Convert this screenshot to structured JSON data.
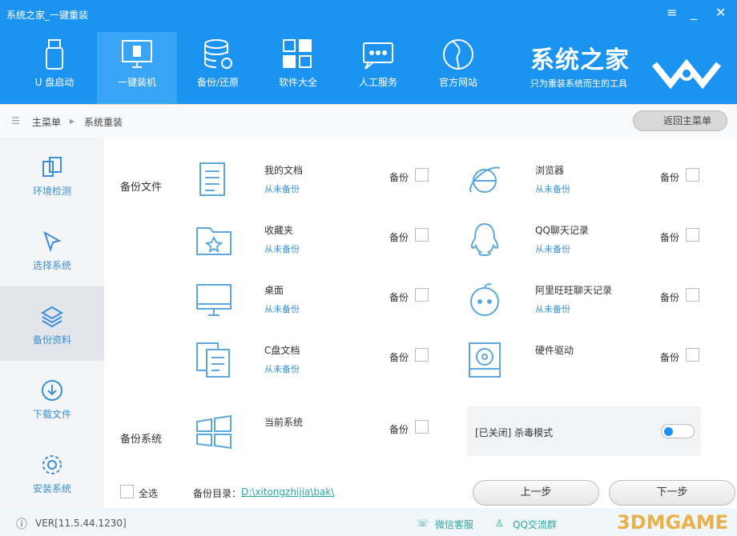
{
  "window": {
    "title": "系统之家_一键重装",
    "menu_icon": "menu-icon",
    "min_icon": "minimize-icon",
    "close_icon": "close-icon"
  },
  "nav": [
    {
      "label": "U 盘启动",
      "icon": "usb-icon"
    },
    {
      "label": "一键装机",
      "icon": "monitor-windows-icon",
      "active": true
    },
    {
      "label": "备份/还原",
      "icon": "database-icon"
    },
    {
      "label": "软件大全",
      "icon": "apps-icon"
    },
    {
      "label": "人工服务",
      "icon": "chat-icon"
    },
    {
      "label": "官方网站",
      "icon": "globe-icon"
    }
  ],
  "brand": {
    "name": "系统之家",
    "slogan": "只为重装系统而生的工具"
  },
  "breadcrumb": {
    "home": "主菜单",
    "current": "系统重装",
    "back": "返回主菜单"
  },
  "sidebar": [
    {
      "label": "环境检测"
    },
    {
      "label": "选择系统"
    },
    {
      "label": "备份资料",
      "active": true
    },
    {
      "label": "下载文件"
    },
    {
      "label": "安装系统"
    }
  ],
  "backup_files": {
    "label": "备份文件",
    "backup_label": "备份",
    "left": [
      {
        "name": "我的文档",
        "status": "从未备份",
        "icon": "document-icon"
      },
      {
        "name": "收藏夹",
        "status": "从未备份",
        "icon": "favorites-folder-icon"
      },
      {
        "name": "桌面",
        "status": "从未备份",
        "icon": "desktop-icon"
      },
      {
        "name": "C盘文档",
        "status": "从未备份",
        "icon": "documents-icon"
      }
    ],
    "right": [
      {
        "name": "浏览器",
        "status": "从未备份",
        "icon": "ie-icon"
      },
      {
        "name": "QQ聊天记录",
        "status": "从未备份",
        "icon": "qq-icon"
      },
      {
        "name": "阿里旺旺聊天记录",
        "status": "从未备份",
        "icon": "wangwang-icon"
      },
      {
        "name": "硬件驱动",
        "status": "",
        "icon": "driver-icon"
      }
    ]
  },
  "backup_system": {
    "label": "备份系统",
    "name": "当前系统",
    "backup_label": "备份"
  },
  "kill_mode": {
    "label": "[已关闭] 杀毒模式"
  },
  "bottom": {
    "select_all": "全选",
    "dir_label": "备份目录：",
    "dir_path": "D:\\xitongzhijia\\bak\\",
    "prev": "上一步",
    "next": "下一步"
  },
  "footer": {
    "version": "VER[11.5.44.1230]",
    "wechat": "微信客服",
    "qq": "QQ交流群",
    "watermark": "3DMGAME"
  }
}
